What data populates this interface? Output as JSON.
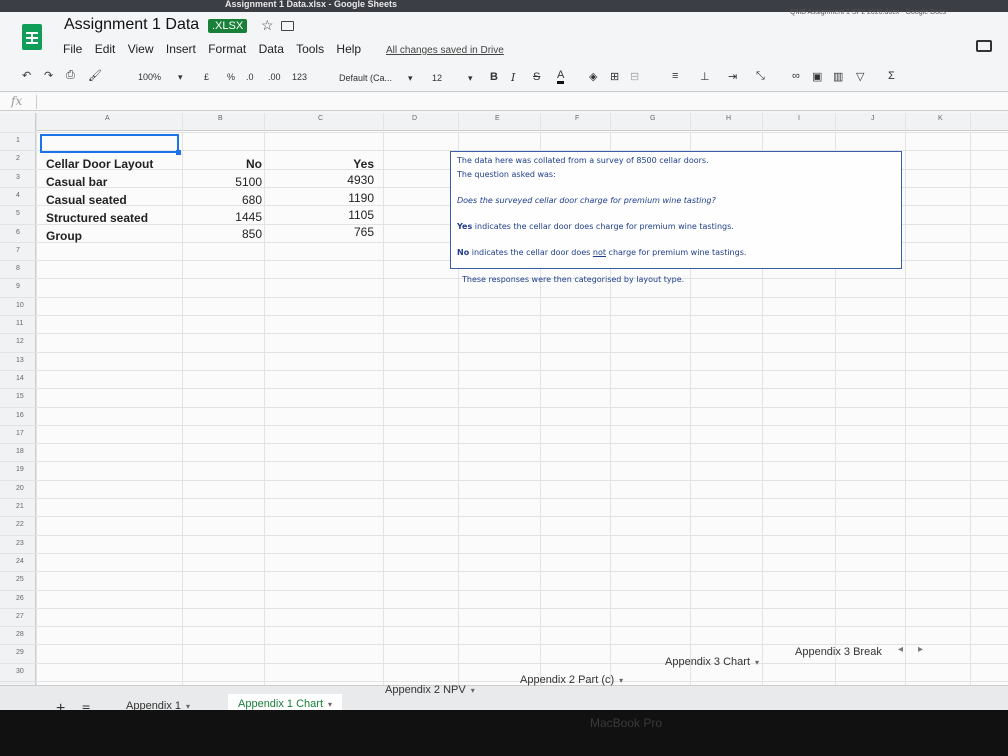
{
  "window": {
    "title": "Assignment 1 Data.xlsx - Google Sheets",
    "other_tab_title": "QMB Assignment 1 SP2 2020.docx - Google Docs"
  },
  "doc": {
    "title": "Assignment 1 Data",
    "extension": ".XLSX",
    "saved_status": "All changes saved in Drive"
  },
  "menu": [
    "File",
    "Edit",
    "View",
    "Insert",
    "Format",
    "Data",
    "Tools",
    "Help"
  ],
  "toolbar": {
    "zoom": "100%",
    "currency": "£",
    "percent": "%",
    "decimal_decrease": ".0",
    "decimal_increase": ".00",
    "format_more": "123",
    "font": "Default (Ca...",
    "font_size": "12",
    "bold": "B",
    "italic": "I",
    "strike": "S",
    "text_color": "A",
    "functions": "Σ"
  },
  "formula_bar": {
    "fx": "fx"
  },
  "columns": [
    "A",
    "B",
    "C",
    "D",
    "E",
    "F",
    "G",
    "H",
    "I",
    "J",
    "K"
  ],
  "rows": [
    "1",
    "2",
    "3",
    "4",
    "5",
    "6",
    "7",
    "8",
    "9",
    "10",
    "11",
    "12",
    "13",
    "14",
    "15",
    "16",
    "17",
    "18",
    "19",
    "20",
    "21",
    "22",
    "23",
    "24",
    "25",
    "26",
    "27",
    "28",
    "29",
    "30"
  ],
  "table": {
    "header": {
      "label": "Cellar Door Layout",
      "no": "No",
      "yes": "Yes"
    },
    "rows": [
      {
        "label": "Casual bar",
        "no": "5100",
        "yes": "4930"
      },
      {
        "label": "Casual seated",
        "no": "680",
        "yes": "1190"
      },
      {
        "label": "Structured seated",
        "no": "1445",
        "yes": "1105"
      },
      {
        "label": "Group",
        "no": "850",
        "yes": "765"
      }
    ]
  },
  "note": {
    "line1": "The data here was collated from a survey of 8500 cellar doors.",
    "line2": "The question asked was:",
    "question": "Does the surveyed cellar door charge for premium wine tasting?",
    "yes_word": "Yes",
    "yes_rest": " indicates the cellar door does charge for premium wine tastings.",
    "no_word": "No",
    "no_mid": " indicates the cellar door does ",
    "no_not": "not",
    "no_rest": " charge for premium wine tastings.",
    "line_after": "These responses were then categorised by layout type."
  },
  "tabs": [
    {
      "label": "Appendix 1"
    },
    {
      "label": "Appendix 1 Chart",
      "active": true
    },
    {
      "label": "Appendix 2 NPV"
    },
    {
      "label": "Appendix 2 Part (c)"
    },
    {
      "label": "Appendix 3 Chart"
    },
    {
      "label": "Appendix 3 Break"
    }
  ],
  "device": {
    "label": "MacBook Pro"
  },
  "colors": {
    "accent": "#188038",
    "selection": "#1a73e8",
    "note_text": "#1f3d8a"
  }
}
